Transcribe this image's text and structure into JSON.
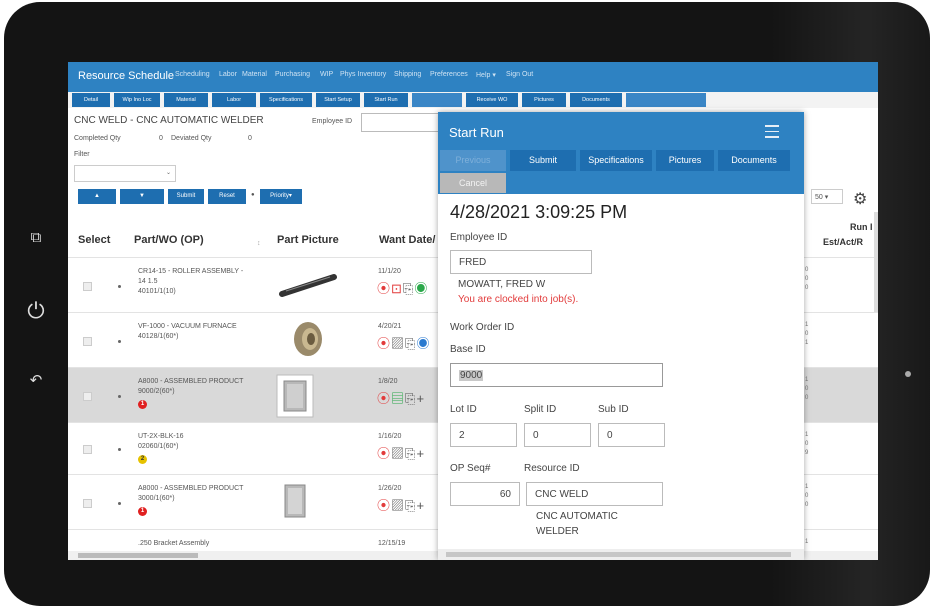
{
  "nav": {
    "brand": "Resource Schedule",
    "items": [
      "Scheduling",
      "Labor",
      "Material",
      "Purchasing",
      "WIP",
      "Phys Inventory",
      "Shipping",
      "Preferences",
      "Help ▾",
      "Sign Out"
    ]
  },
  "subnav": [
    "Detail",
    "Wip Ino Loc",
    "Material",
    "Labor",
    "Specifications",
    "Start Setup",
    "Start Run",
    "",
    "Receive WO",
    "Pictures",
    "Documents",
    ""
  ],
  "header": {
    "title": "CNC WELD - CNC AUTOMATIC WELDER",
    "employee_label": "Employee ID",
    "completed_label": "Completed Qty",
    "completed_value": "0",
    "deviated_label": "Deviated Qty",
    "deviated_value": "0",
    "filter_label": "Filter"
  },
  "toolbar": {
    "up": "▲",
    "down": "▼",
    "submit": "Submit",
    "reset": "Reset",
    "priority": "Priority▾",
    "page_size": "50 ▾"
  },
  "table": {
    "headers": [
      "Select",
      "Part/WO (OP)",
      "Part Picture",
      "Want Date/",
      "Run I",
      "Est/Act/R"
    ],
    "rows": [
      {
        "part": "CR14-15 - ROLLER ASSEMBLY -",
        "part2": "14 1.5",
        "wo": "40101/1(10)",
        "date": "11/1/20",
        "badge": "",
        "nums": [
          "0",
          "0",
          "0"
        ]
      },
      {
        "part": "VF-1000 - VACUUM FURNACE",
        "part2": "",
        "wo": "40128/1(60*)",
        "date": "4/20/21",
        "badge": "",
        "nums": [
          "1",
          "0",
          "1"
        ]
      },
      {
        "part": "A8000 - ASSEMBLED PRODUCT",
        "part2": "",
        "wo": "9000/2(60*)",
        "date": "1/8/20",
        "badge": "1",
        "nums": [
          "1",
          "0",
          "0"
        ]
      },
      {
        "part": "UT-2X-BLK-16",
        "part2": "",
        "wo": "02060/1(60*)",
        "date": "1/16/20",
        "badge": "2",
        "nums": [
          "1",
          "0",
          "9"
        ]
      },
      {
        "part": "A8000 - ASSEMBLED PRODUCT",
        "part2": "",
        "wo": "3000/1(60*)",
        "date": "1/26/20",
        "badge": "1",
        "nums": [
          "1",
          "0",
          "0"
        ]
      },
      {
        "part": ".250 Bracket Assembly",
        "part2": "",
        "wo": "",
        "date": "12/15/19",
        "badge": "",
        "nums": [
          "1"
        ]
      }
    ]
  },
  "modal": {
    "title": "Start Run",
    "buttons": [
      "Previous",
      "Submit",
      "Specifications",
      "Pictures",
      "Documents"
    ],
    "cancel": "Cancel",
    "datetime": "4/28/2021 3:09:25 PM",
    "employee_label": "Employee ID",
    "employee_value": "FRED",
    "employee_name": "MOWATT, FRED W",
    "clocked_msg": "You are clocked into job(s).",
    "work_order_label": "Work Order ID",
    "base_label": "Base ID",
    "base_value": "9000",
    "lot_label": "Lot ID",
    "lot_value": "2",
    "split_label": "Split ID",
    "split_value": "0",
    "sub_label": "Sub ID",
    "sub_value": "0",
    "op_label": "OP Seq#",
    "op_value": "60",
    "resource_label": "Resource ID",
    "resource_value": "CNC WELD",
    "resource_desc1": "CNC AUTOMATIC",
    "resource_desc2": "WELDER"
  },
  "colors": {
    "primary": "#2e82c2",
    "button": "#1e6eb0",
    "error": "#e23b3b"
  }
}
